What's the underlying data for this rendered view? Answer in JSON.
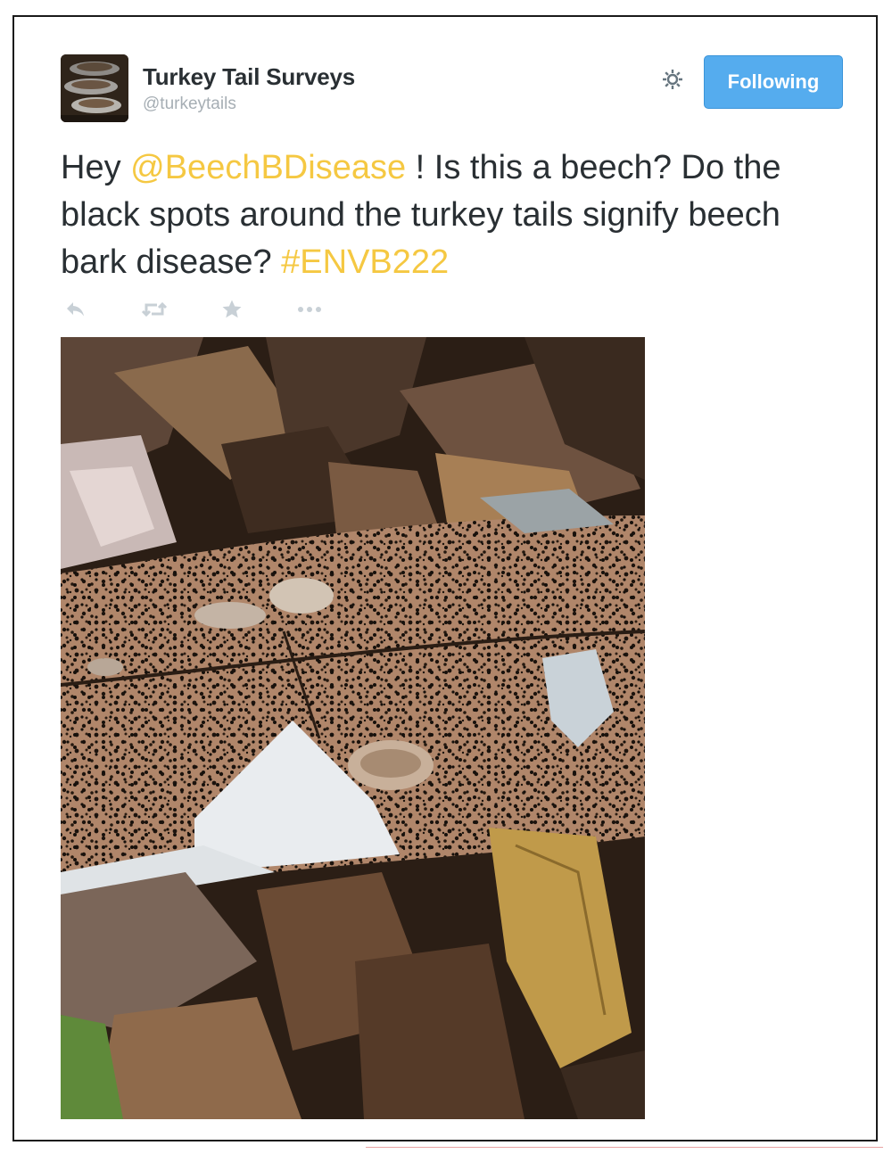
{
  "tweet": {
    "author": {
      "display_name": "Turkey Tail Surveys",
      "handle": "@turkeytails",
      "avatar_icon": "turkey-tail-fungus-avatar"
    },
    "follow_button_label": "Following",
    "settings_icon": "gear-icon",
    "text_parts": {
      "prefix": "Hey ",
      "mention": "@BeechBDisease",
      "middle": " ! Is this a beech? Do the black spots around the turkey tails signify beech bark disease? ",
      "hashtag": "#ENVB222"
    },
    "actions": [
      "reply-icon",
      "retweet-icon",
      "favorite-icon",
      "more-icon"
    ],
    "photo_icon": "fallen-beech-log-photo"
  },
  "colors": {
    "link": "#f5c842",
    "follow_button": "#55acee",
    "text": "#292f33",
    "muted": "#a6aeb4"
  }
}
